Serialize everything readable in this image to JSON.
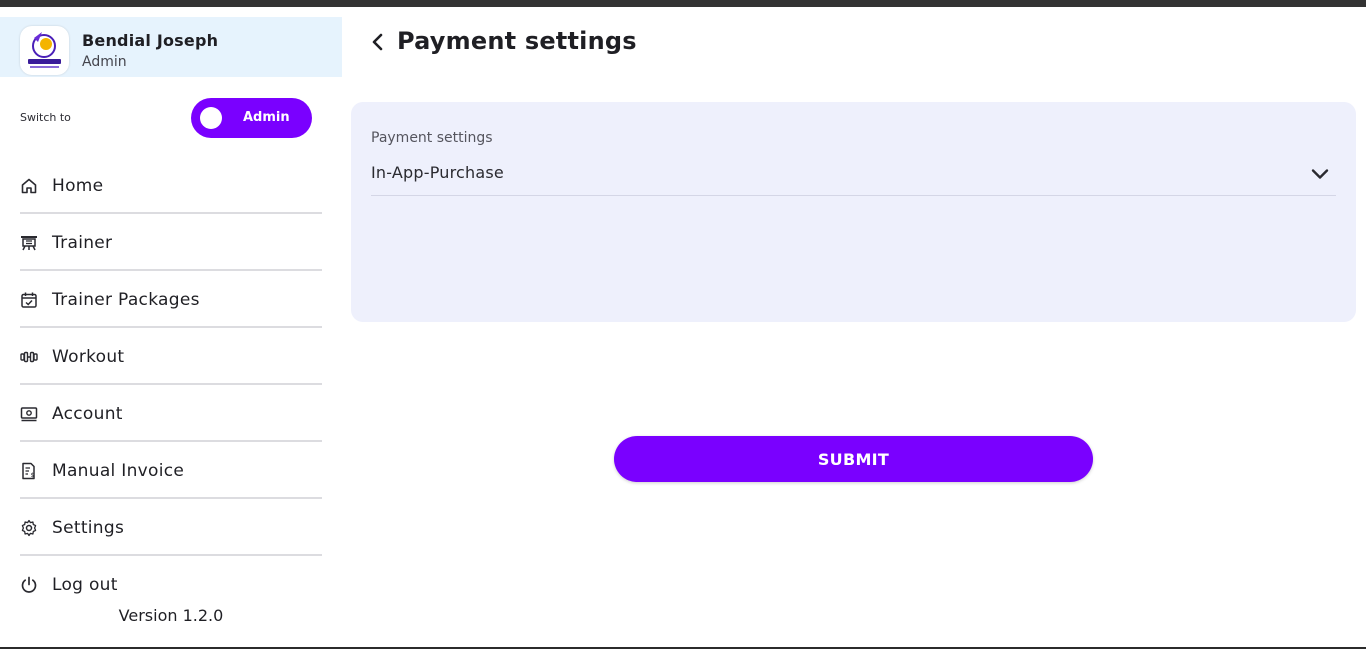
{
  "profile": {
    "name": "Bendial Joseph",
    "role": "Admin"
  },
  "switcher": {
    "label": "Switch to",
    "value": "Admin"
  },
  "nav": [
    {
      "label": "Home",
      "icon": "home-icon"
    },
    {
      "label": "Trainer",
      "icon": "trainer-icon"
    },
    {
      "label": "Trainer Packages",
      "icon": "calendar-check-icon"
    },
    {
      "label": "Workout",
      "icon": "dumbbell-icon"
    },
    {
      "label": "Account",
      "icon": "wallet-icon"
    },
    {
      "label": "Manual Invoice",
      "icon": "invoice-icon"
    },
    {
      "label": "Settings",
      "icon": "gear-icon"
    },
    {
      "label": "Log out",
      "icon": "power-icon"
    }
  ],
  "version": "Version 1.2.0",
  "page": {
    "title": "Payment settings"
  },
  "form": {
    "field_label": "Payment settings",
    "selected_value": "In-App-Purchase"
  },
  "submit_label": "SUBMIT",
  "colors": {
    "accent": "#7a00ff",
    "card_bg": "#eef0fc",
    "profile_bg": "#e6f3fd"
  }
}
